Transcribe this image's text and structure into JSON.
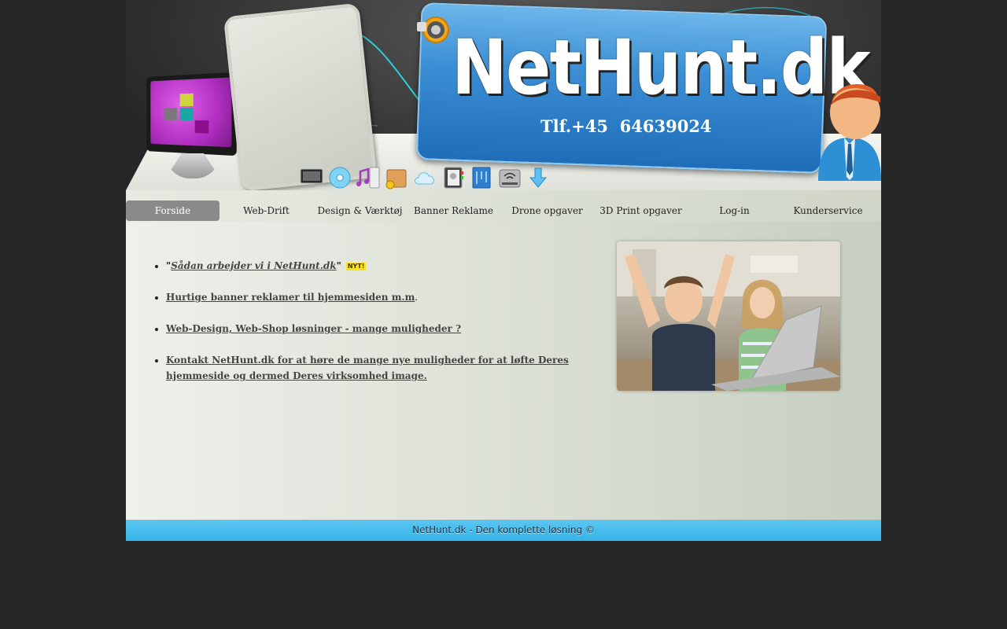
{
  "header": {
    "logo": "NetHunt.dk",
    "phone": "Tlf.+45  64639024",
    "toolbar_icons": [
      "monitor-icon",
      "disc-icon",
      "music-icon",
      "package-icon",
      "cloud-icon",
      "address-book-icon",
      "blueprint-icon",
      "router-icon",
      "download-arrow-icon"
    ]
  },
  "nav": {
    "items": [
      {
        "label": "Forside",
        "active": true
      },
      {
        "label": "Web-Drift"
      },
      {
        "label": "Design & Værktøj"
      },
      {
        "label": "Banner Reklame"
      },
      {
        "label": "Drone opgaver"
      },
      {
        "label": "3D Print opgaver"
      },
      {
        "label": "Log-in"
      },
      {
        "label": "Kunderservice"
      }
    ]
  },
  "content": {
    "items": [
      {
        "prefix": "\"",
        "link": "Sådan arbejder vi i NetHunt.dk",
        "suffix": "\"",
        "badge": "NYT!"
      },
      {
        "link": "Hurtige banner reklamer til hjemmesiden m.m",
        "suffix": "."
      },
      {
        "link": "Web-Design, Web-Shop løsninger - mange muligheder ?"
      },
      {
        "link": "Kontakt NetHunt.dk for at høre de mange nye muligheder for at løfte Deres hjemmeside og dermed Deres virksomhed image."
      }
    ]
  },
  "footer": {
    "text": "NetHunt.dk - Den komplette løsning ©"
  },
  "colors": {
    "background": "#262626",
    "accent": "#3b8ed4",
    "footer": "#35b3e8",
    "nav_active": "#8a8a8a"
  }
}
